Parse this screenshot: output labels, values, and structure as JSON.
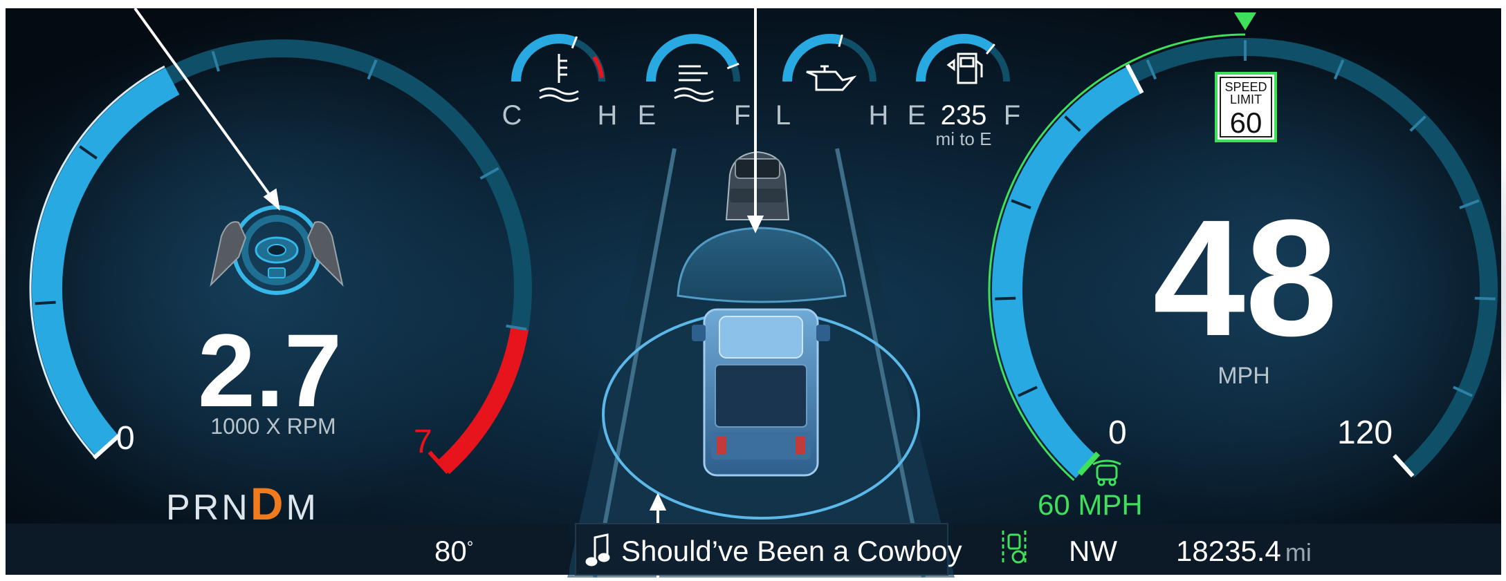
{
  "tachometer": {
    "rpm_value": "2.7",
    "unit_label": "1000 X RPM",
    "min_label": "0",
    "redline_label": "7",
    "rpm": 2.7,
    "rpm_max": 7
  },
  "gear_selector": {
    "gears": [
      "P",
      "R",
      "N",
      "D",
      "M"
    ],
    "active_gear": "D",
    "active_color": "#f07b1e"
  },
  "mini_gauges": [
    {
      "name": "coolant-temp",
      "icon": "coolant-temperature-icon",
      "left_label": "C",
      "right_label": "H",
      "level": 0.62
    },
    {
      "name": "fuel-level",
      "icon": "fuel-level-icon",
      "left_label": "E",
      "right_label": "F",
      "level": 0.88
    },
    {
      "name": "oil-pressure",
      "icon": "oil-can-icon",
      "left_label": "L",
      "right_label": "H",
      "level": 0.58
    },
    {
      "name": "fuel-range",
      "icon": "fuel-pump-icon",
      "left_label": "E",
      "right_label": "F",
      "level": 0.72,
      "value": "235",
      "sublabel": "mi to E"
    }
  ],
  "speedometer": {
    "speed_value": "48",
    "unit_label": "MPH",
    "min_label": "0",
    "max_label": "120",
    "speed": 48,
    "speed_max": 120,
    "speed_limit_top": "SPEED",
    "speed_limit_mid": "LIMIT",
    "speed_limit_value": "60",
    "cruise_set_label": "60 MPH",
    "cruise_color": "#3fe05a"
  },
  "bottom_bar": {
    "temperature": "80",
    "temperature_unit": "°",
    "music_track": "Should’ve Been a Cowboy",
    "compass_heading": "NW",
    "odometer_value": "18235.4",
    "odometer_unit": "mi"
  },
  "colors": {
    "accent_blue": "#29a9e1",
    "dark_blue_arc": "#0f4f68",
    "redline": "#e8141b",
    "background": "#06111c",
    "speed_limit_green": "#3fe05a"
  }
}
